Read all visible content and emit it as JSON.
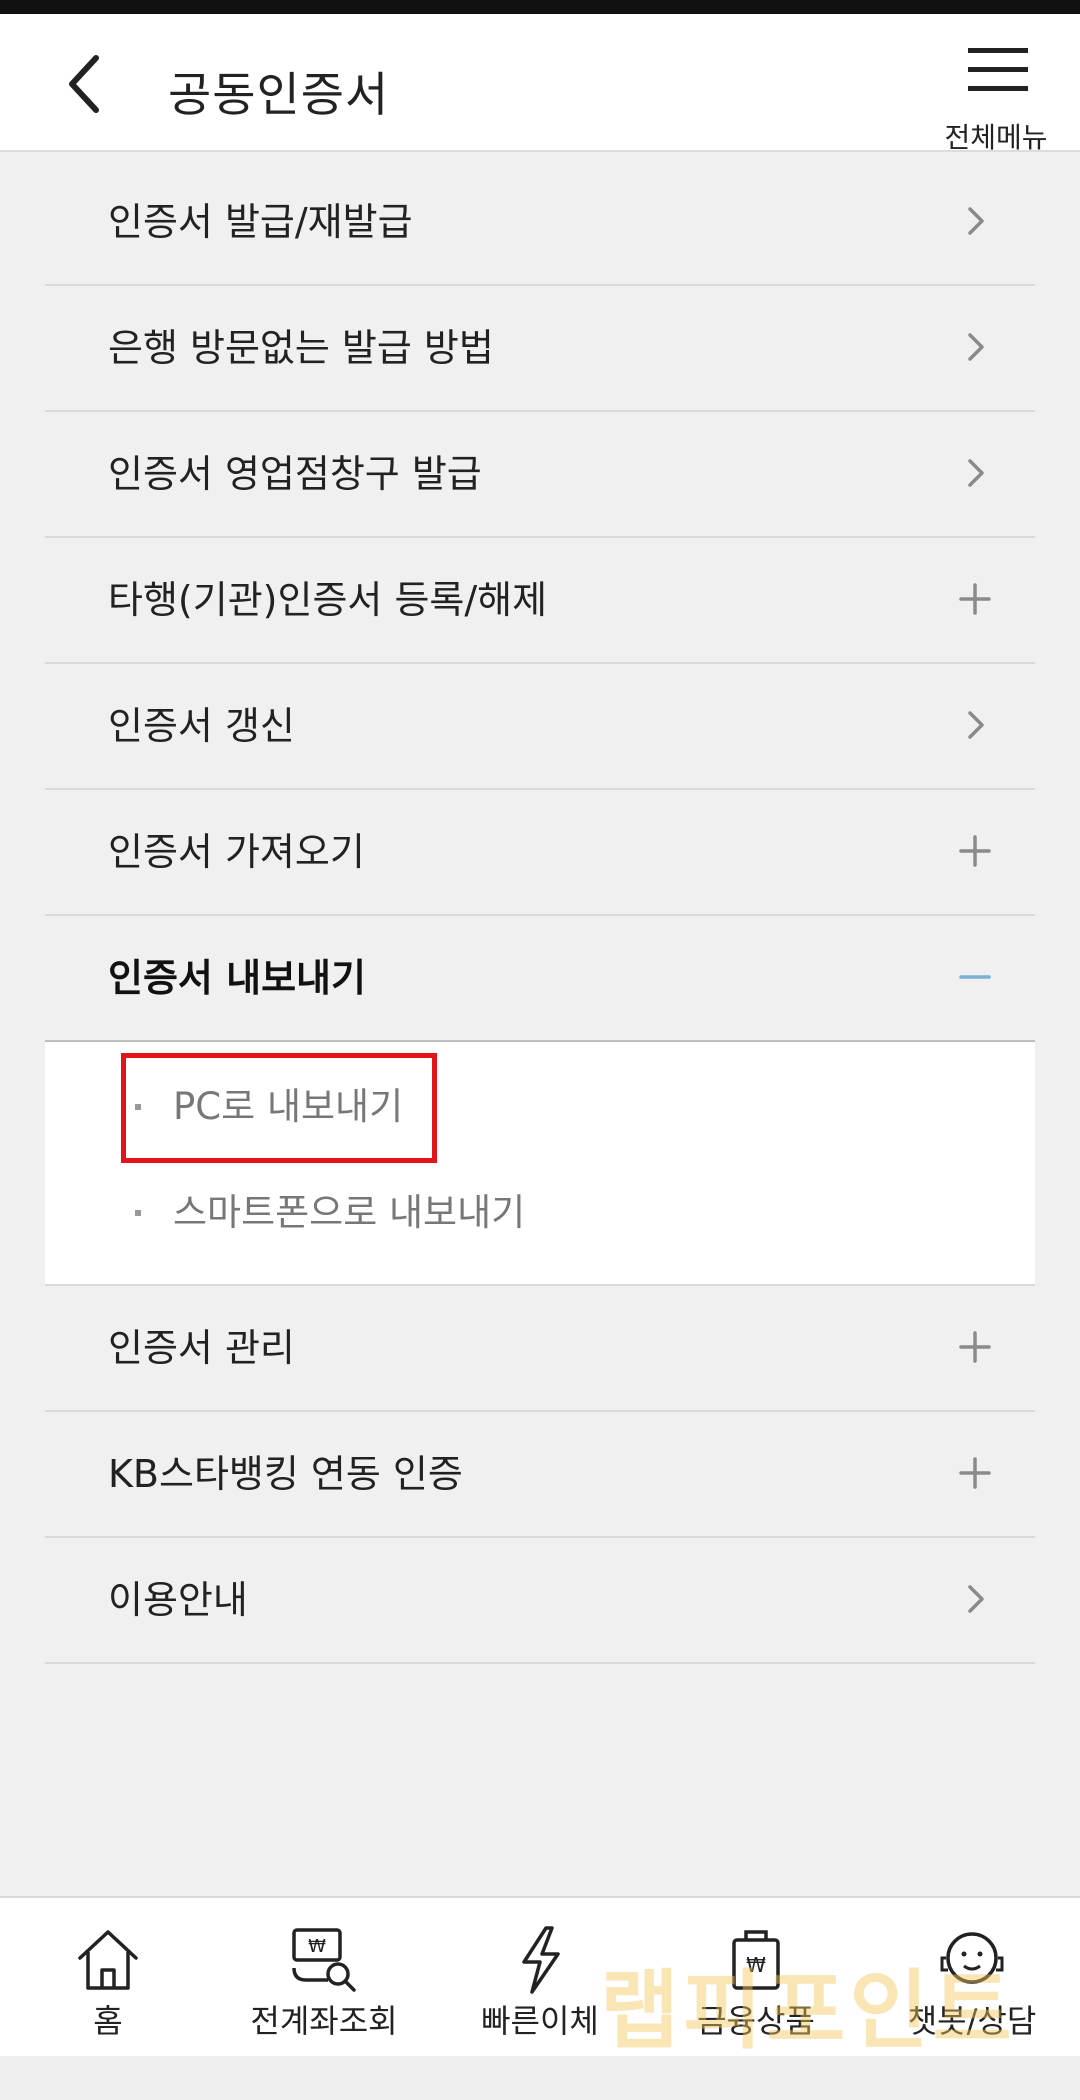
{
  "header": {
    "title": "공동인증서",
    "menu_label": "전체메뉴"
  },
  "menu": {
    "items": [
      {
        "label": "인증서 발급/재발급",
        "indicator": "chevron-right"
      },
      {
        "label": "은행 방문없는 발급 방법",
        "indicator": "chevron-right"
      },
      {
        "label": "인증서 영업점창구 발급",
        "indicator": "chevron-right"
      },
      {
        "label": "타행(기관)인증서 등록/해제",
        "indicator": "plus"
      },
      {
        "label": "인증서 갱신",
        "indicator": "chevron-right"
      },
      {
        "label": "인증서 가져오기",
        "indicator": "plus"
      },
      {
        "label": "인증서 내보내기",
        "indicator": "minus",
        "expanded": true
      },
      {
        "label": "인증서 관리",
        "indicator": "plus"
      },
      {
        "label": "KB스타뱅킹 연동 인증",
        "indicator": "plus"
      },
      {
        "label": "이용안내",
        "indicator": "chevron-right"
      }
    ],
    "submenu": [
      {
        "label": "PC로 내보내기",
        "highlighted": true
      },
      {
        "label": "스마트폰으로 내보내기"
      }
    ]
  },
  "bottom_nav": {
    "items": [
      {
        "label": "홈",
        "icon": "home-icon"
      },
      {
        "label": "전계좌조회",
        "icon": "account-search-icon"
      },
      {
        "label": "빠른이체",
        "icon": "lightning-icon"
      },
      {
        "label": "금융상품",
        "icon": "product-bag-icon"
      },
      {
        "label": "챗봇/상담",
        "icon": "chatbot-icon"
      }
    ]
  },
  "watermark": "랩피포인트",
  "colors": {
    "accent_minus": "#7ab0d6",
    "highlight": "#e1141b"
  }
}
